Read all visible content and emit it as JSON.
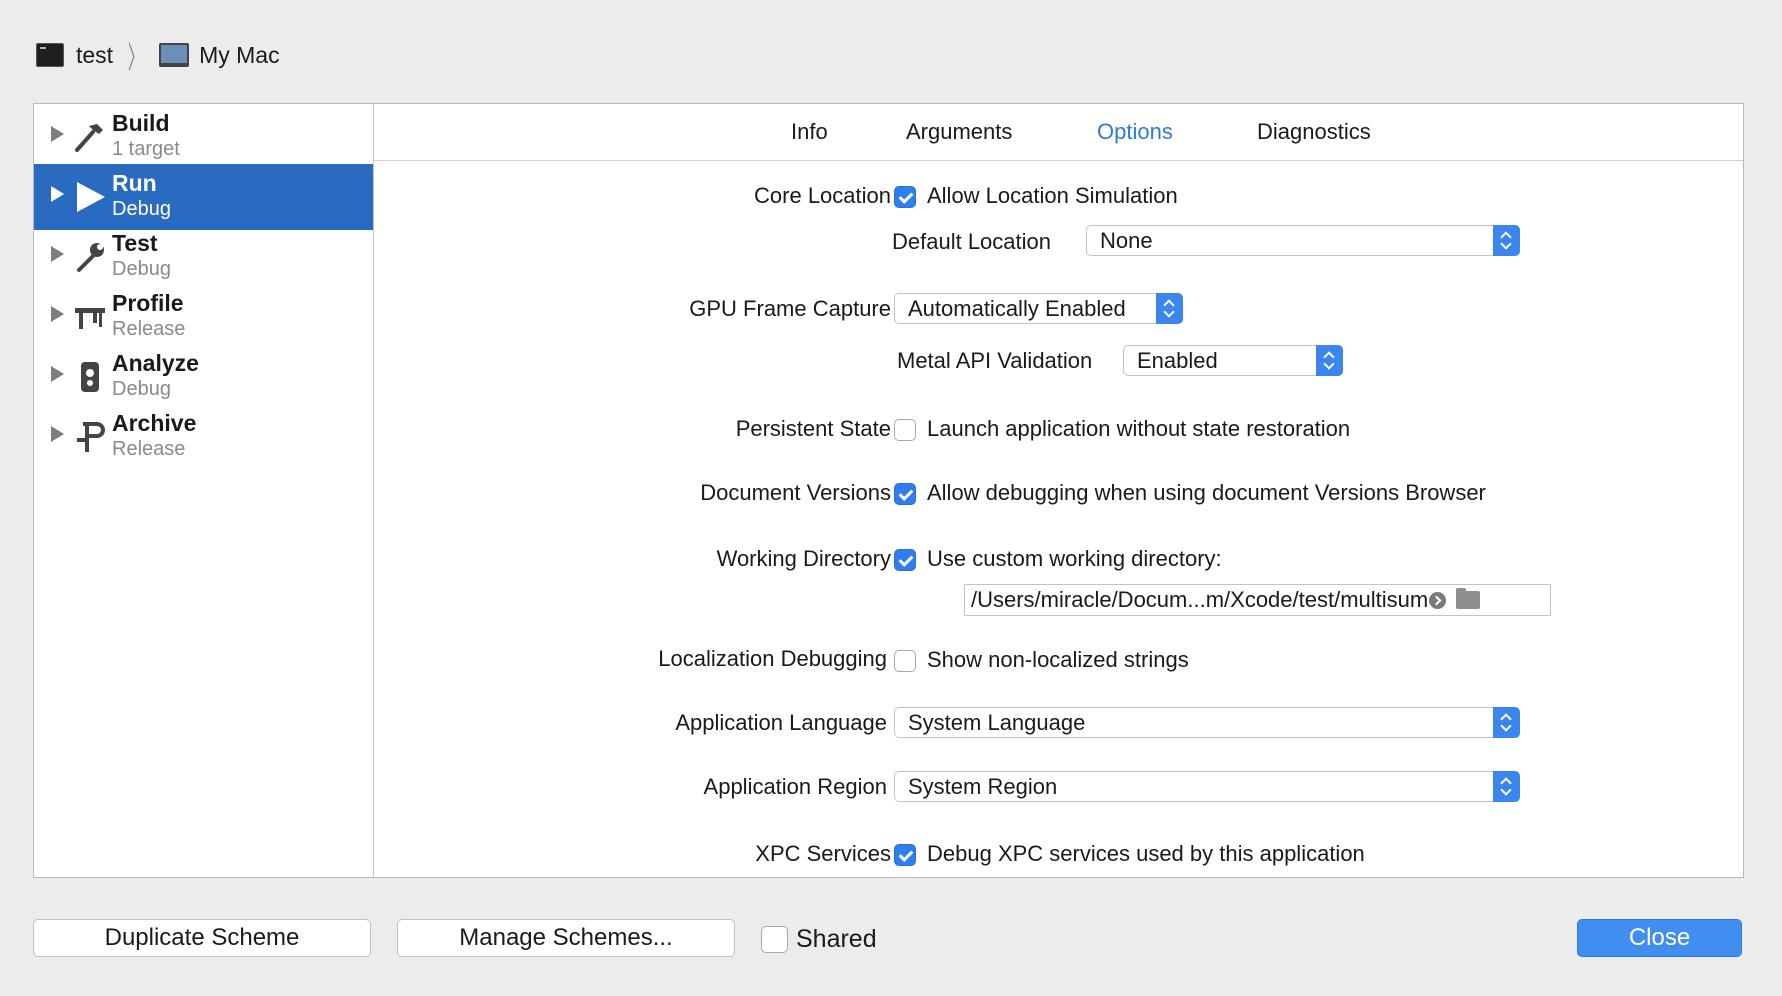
{
  "breadcrumb": {
    "scheme": "test",
    "destination": "My Mac"
  },
  "sidebar": {
    "items": [
      {
        "name": "Build",
        "sub": "1 target",
        "icon": "hammer-icon",
        "selected": false
      },
      {
        "name": "Run",
        "sub": "Debug",
        "icon": "play-icon",
        "selected": true
      },
      {
        "name": "Test",
        "sub": "Debug",
        "icon": "wrench-icon",
        "selected": false
      },
      {
        "name": "Profile",
        "sub": "Release",
        "icon": "caliper-icon",
        "selected": false
      },
      {
        "name": "Analyze",
        "sub": "Debug",
        "icon": "analyze-icon",
        "selected": false
      },
      {
        "name": "Archive",
        "sub": "Release",
        "icon": "archive-icon",
        "selected": false
      }
    ]
  },
  "tabs": [
    {
      "label": "Info",
      "active": false
    },
    {
      "label": "Arguments",
      "active": false
    },
    {
      "label": "Options",
      "active": true
    },
    {
      "label": "Diagnostics",
      "active": false
    }
  ],
  "options": {
    "core_location": {
      "label": "Core Location",
      "checkbox_label": "Allow Location Simulation",
      "checked": true
    },
    "default_location": {
      "label": "Default Location",
      "value": "None"
    },
    "gpu_frame_capture": {
      "label": "GPU Frame Capture",
      "value": "Automatically Enabled"
    },
    "metal_api_validation": {
      "label": "Metal API Validation",
      "value": "Enabled"
    },
    "persistent_state": {
      "label": "Persistent State",
      "checkbox_label": "Launch application without state restoration",
      "checked": false
    },
    "document_versions": {
      "label": "Document Versions",
      "checkbox_label": "Allow debugging when using document Versions Browser",
      "checked": true
    },
    "working_directory": {
      "label": "Working Directory",
      "checkbox_label": "Use custom working directory:",
      "checked": true,
      "path": "/Users/miracle/Docum...m/Xcode/test/multisum"
    },
    "localization_debugging": {
      "label": "Localization Debugging",
      "checkbox_label": "Show non-localized strings",
      "checked": false
    },
    "application_language": {
      "label": "Application Language",
      "value": "System Language"
    },
    "application_region": {
      "label": "Application Region",
      "value": "System Region"
    },
    "xpc_services": {
      "label": "XPC Services",
      "checkbox_label": "Debug XPC services used by this application",
      "checked": true
    }
  },
  "footer": {
    "duplicate_label": "Duplicate Scheme",
    "manage_label": "Manage Schemes...",
    "shared_label": "Shared",
    "shared_checked": false,
    "close_label": "Close"
  },
  "colors": {
    "accent": "#2a6bc2",
    "tab_active": "#2f7cd6",
    "button_primary": "#3f8ef0"
  }
}
